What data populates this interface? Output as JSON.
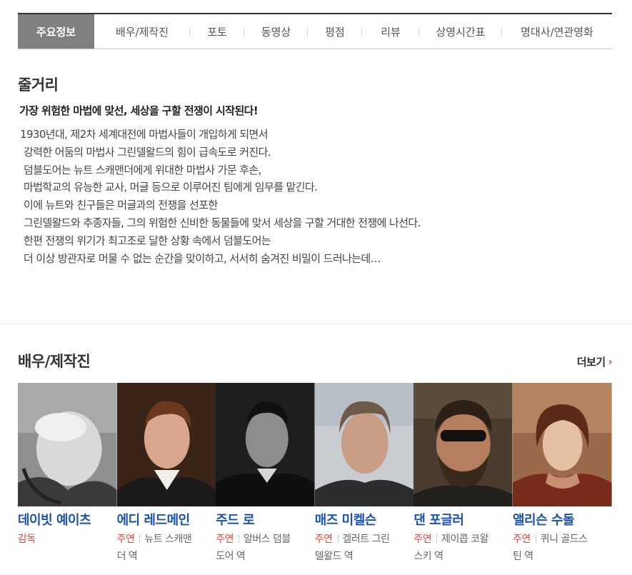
{
  "tabs": [
    {
      "label": "주요정보",
      "active": true
    },
    {
      "label": "배우/제작진",
      "active": false
    },
    {
      "label": "포토",
      "active": false
    },
    {
      "label": "동영상",
      "active": false
    },
    {
      "label": "평점",
      "active": false
    },
    {
      "label": "리뷰",
      "active": false
    },
    {
      "label": "상영시간표",
      "active": false
    },
    {
      "label": "명대사/연관영화",
      "active": false
    }
  ],
  "synopsis": {
    "title": "줄거리",
    "headline": "가장 위험한 마법에 맞선, 세상을 구할 전쟁이 시작된다!",
    "lines": [
      "1930년대, 제2차 세계대전에 마법사들이 개입하게 되면서",
      "강력한 어둠의 마법사 그린델왈드의 힘이 급속도로 커진다.",
      "덤블도어는 뉴트 스캐맨더에게 위대한 마법사 가문 후손,",
      "마법학교의 유능한 교사, 머글 등으로 이루어진 팀에게 임무를 맡긴다.",
      "이에 뉴트와 친구들은 머글과의 전쟁을 선포한",
      "그린델왈드와 추종자들, 그의 위험한 신비한 동물들에 맞서 세상을 구할 거대한 전쟁에 나선다.",
      "한편 전쟁의 위기가 최고조로 달한 상황 속에서 덤블도어는",
      "더 이상 방관자로 머물 수 없는 순간을 맞이하고, 서서히 숨겨진 비밀이 드러나는데…"
    ]
  },
  "cast_section": {
    "title": "배우/제작진",
    "more_label": "더보기",
    "more_icon": "chevron-right-icon",
    "members": [
      {
        "name": "데이빗 예이츠",
        "role": "감독",
        "character_lines": []
      },
      {
        "name": "에디 레드메인",
        "role": "주연",
        "character_lines": [
          "뉴트 스캐맨",
          "더 역"
        ]
      },
      {
        "name": "주드 로",
        "role": "주연",
        "character_lines": [
          "알버스 덤블",
          "도어 역"
        ]
      },
      {
        "name": "매즈 미켈슨",
        "role": "주연",
        "character_lines": [
          "겔러트 그린",
          "델왈드 역"
        ]
      },
      {
        "name": "댄 포글러",
        "role": "주연",
        "character_lines": [
          "제이콥 코왈",
          "스키 역"
        ]
      },
      {
        "name": "앨리슨 수돌",
        "role": "주연",
        "character_lines": [
          "퀴니 골드스",
          "틴 역"
        ]
      }
    ]
  },
  "colors": {
    "active_tab": "#808080",
    "link_blue": "#1a52b0",
    "role_red": "#e2463b"
  }
}
